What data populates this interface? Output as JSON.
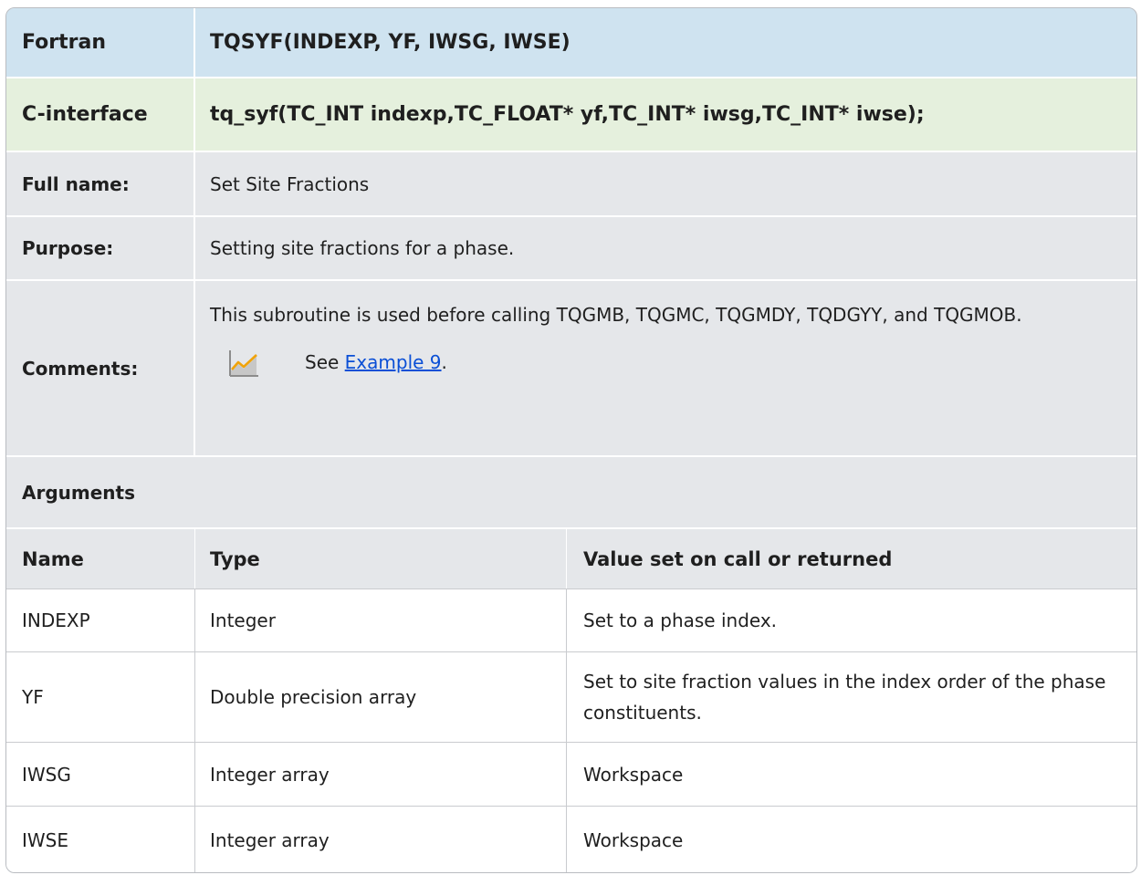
{
  "fortran": {
    "label": "Fortran",
    "value": "TQSYF(INDEXP, YF, IWSG, IWSE)"
  },
  "c_interface": {
    "label": "C-interface",
    "value": "tq_syf(TC_INT indexp,TC_FLOAT* yf,TC_INT* iwsg,TC_INT* iwse);"
  },
  "full_name": {
    "label": "Full name:",
    "value": "Set Site Fractions"
  },
  "purpose": {
    "label": "Purpose:",
    "value": "Setting site fractions for a phase."
  },
  "comments": {
    "label": "Comments:",
    "text": "This subroutine is used before calling TQGMB, TQGMC, TQGMDY, TQDGYY, and TQGMOB.",
    "see_prefix": "See ",
    "see_link": "Example 9",
    "see_suffix": ".",
    "icon": "chart-icon"
  },
  "arguments": {
    "title": "Arguments",
    "headers": [
      "Name",
      "Type",
      "Value set on call or returned"
    ],
    "rows": [
      {
        "name": "INDEXP",
        "type": "Integer",
        "value": "Set to a phase index."
      },
      {
        "name": "YF",
        "type": "Double precision array",
        "value": "Set to site fraction values in the index order of the phase constituents."
      },
      {
        "name": "IWSG",
        "type": "Integer array",
        "value": "Workspace"
      },
      {
        "name": "IWSE",
        "type": "Integer array",
        "value": "Workspace"
      }
    ]
  },
  "colors": {
    "header_blue": "#cfe3f0",
    "header_green": "#e5f0dd",
    "row_gray": "#e5e7ea",
    "link": "#0a4fd6"
  }
}
